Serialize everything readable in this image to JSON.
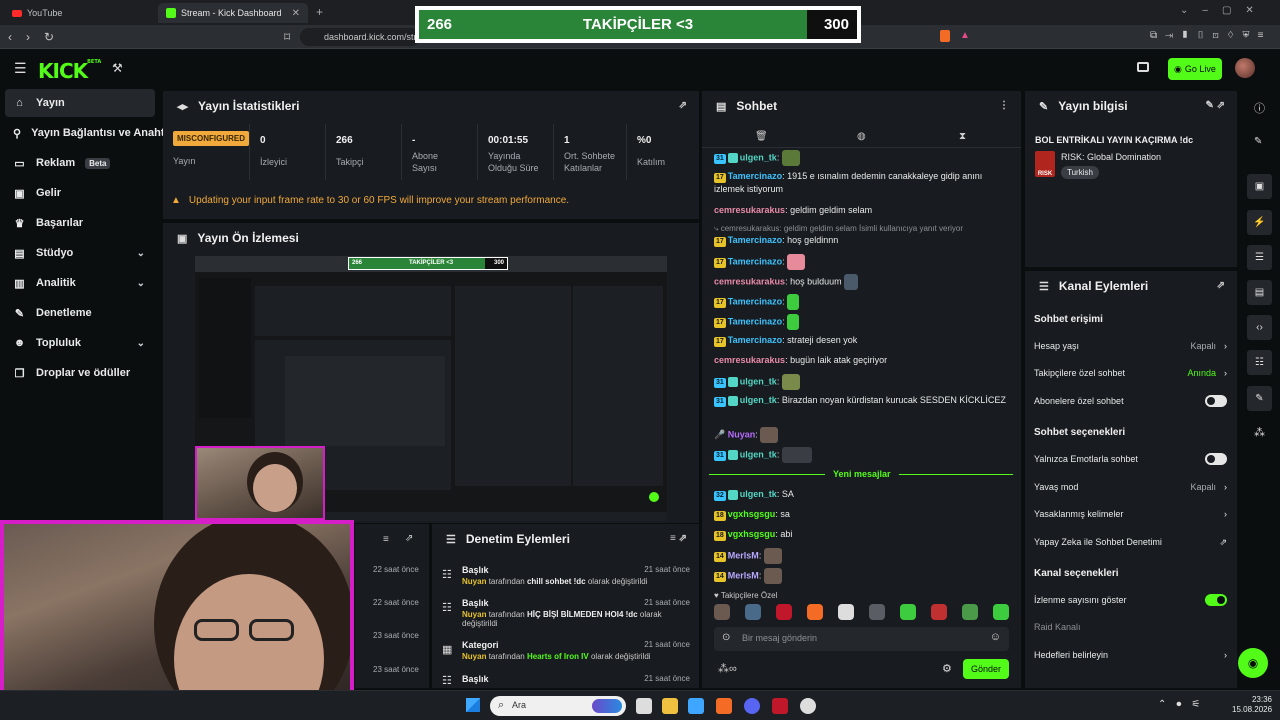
{
  "browser": {
    "tabs": [
      {
        "label": "YouTube"
      },
      {
        "label": "Stream - Kick Dashboard"
      }
    ],
    "url": "dashboard.kick.com/str"
  },
  "overlay": {
    "current": "266",
    "title": "TAKİPÇİLER <3",
    "goal": "300",
    "progress": 0.8867
  },
  "app": {
    "logo": "KICK",
    "logo_sup": "BETA",
    "go_live": "Go Live"
  },
  "sidebar": {
    "items": [
      {
        "label": "Yayın",
        "icon": "home-icon"
      },
      {
        "label": "Yayın Bağlantısı ve Anahtar",
        "icon": "link-icon"
      },
      {
        "label": "Reklam",
        "badge": "Beta",
        "icon": "monitor-icon"
      },
      {
        "label": "Gelir",
        "icon": "money-icon"
      },
      {
        "label": "Başarılar",
        "icon": "trophy-icon"
      },
      {
        "label": "Stüdyo",
        "icon": "studio-icon"
      },
      {
        "label": "Analitik",
        "icon": "chart-icon"
      },
      {
        "label": "Denetleme",
        "icon": "wrench-icon"
      },
      {
        "label": "Topluluk",
        "icon": "community-icon"
      },
      {
        "label": "Droplar ve ödüller",
        "icon": "gift-icon"
      }
    ]
  },
  "stats": {
    "title": "Yayın İstatistikleri",
    "status_badge": "MISCONFIGURED",
    "status_label": "Yayın",
    "items": [
      {
        "value": "0",
        "label": "İzleyici"
      },
      {
        "value": "266",
        "label": "Takipçi"
      },
      {
        "value": "-",
        "label": "Abone Sayısı"
      },
      {
        "value": "00:01:55",
        "label": "Yayında Olduğu Süre"
      },
      {
        "value": "1",
        "label": "Ort. Sohbete Katılanlar"
      },
      {
        "value": "%0",
        "label": "Katılım"
      }
    ],
    "warning": "Updating your input frame rate to 30 or 60 FPS will improve your stream performance."
  },
  "preview": {
    "title": "Yayın Ön İzlemesi"
  },
  "feed": {
    "times": [
      "22 saat önce",
      "22 saat önce",
      "23 saat önce",
      "23 saat önce"
    ]
  },
  "mod": {
    "title": "Denetim Eylemleri",
    "items": [
      {
        "type": "Başlık",
        "time": "21 saat önce",
        "user": "Nuyan",
        "text": "tarafından",
        "value": "chill sohbet !dc",
        "suffix": "olarak değiştirildi"
      },
      {
        "type": "Başlık",
        "time": "21 saat önce",
        "user": "Nuyan",
        "text": "tarafından",
        "value": "HİÇ BİŞİ BİLMEDEN HOI4 !dc",
        "suffix": "olarak değiştirildi"
      },
      {
        "type": "Kategori",
        "time": "21 saat önce",
        "user": "Nuyan",
        "text": "tarafından",
        "value": "Hearts of Iron IV",
        "suffix": "olarak değiştirildi"
      },
      {
        "type": "Başlık",
        "time": "21 saat önce"
      }
    ]
  },
  "chat": {
    "title": "Sohbet",
    "messages": [
      {
        "user": "ulgen_tk",
        "text": ""
      },
      {
        "user": "Tamercinazo",
        "text": "1915 e ısınalım dedemin canakkaleye gidip anını izlemek istiyorum"
      },
      {
        "user": "cemresukarakus",
        "text": "geldim geldim selam"
      },
      {
        "reply": "cemresukarakus: geldim geldim selam İsimli kullanıcıya yanıt veriyor"
      },
      {
        "user": "Tamercinazo",
        "text": "hoş geldinnn"
      },
      {
        "user": "Tamercinazo",
        "text": ""
      },
      {
        "user": "cemresukarakus",
        "text": "hoş bulduum"
      },
      {
        "user": "Tamercinazo",
        "text": ""
      },
      {
        "user": "Tamercinazo",
        "text": ""
      },
      {
        "user": "Tamercinazo",
        "text": "strateji desen yok"
      },
      {
        "user": "cemresukarakus",
        "text": "bugün laik atak geçiriyor"
      },
      {
        "user": "ulgen_tk",
        "text": ""
      },
      {
        "user": "ulgen_tk",
        "text": "Birazdan noyan kürdistan kurucak SESDEN KİCKLİCEZ"
      },
      {
        "user": "Nuyan",
        "text": ""
      },
      {
        "user": "ulgen_tk",
        "text": ""
      },
      {
        "user": "ulgen_tk",
        "text": "SA"
      },
      {
        "user": "vgxhsgsgu",
        "text": "sa"
      },
      {
        "user": "vgxhsgsgu",
        "text": "abi"
      },
      {
        "user": "MerlsM",
        "text": ""
      },
      {
        "user": "MerlsM",
        "text": ""
      }
    ],
    "new_messages": "Yeni mesajlar",
    "followers_only": "Takipçilere Özel",
    "placeholder": "Bir mesaj gönderin",
    "send": "Gönder",
    "badges": {
      "b17": "17",
      "b31": "31",
      "b32": "32",
      "b18": "18",
      "b14": "14"
    }
  },
  "info": {
    "title": "Yayın bilgisi",
    "stream_title": "BOL ENTRİKALI YAYIN KAÇIRMA !dc",
    "category": "RISK: Global Domination",
    "tag": "Turkish",
    "game_thumb": "RISK"
  },
  "channel": {
    "title": "Kanal Eylemleri",
    "chat_access": "Sohbet erişimi",
    "account_age": "Hesap yaşı",
    "account_age_val": "Kapalı",
    "followers_chat": "Takipçilere özel sohbet",
    "followers_chat_val": "Anında",
    "subs_chat": "Abonelere özel sohbet",
    "chat_options": "Sohbet seçenekleri",
    "emote_only": "Yalnızca Emotlarla sohbet",
    "slow_mode": "Yavaş mod",
    "slow_mode_val": "Kapalı",
    "banned_words": "Yasaklanmış kelimeler",
    "ai_mod": "Yapay Zeka ile Sohbet Denetimi",
    "channel_options": "Kanal seçenekleri",
    "show_viewers": "İzlenme sayısını göster",
    "raid": "Raid Kanalı",
    "goals": "Hedefleri belirleyin"
  },
  "taskbar": {
    "search": "Ara",
    "time": "23:36",
    "date": "15.08.2026"
  }
}
